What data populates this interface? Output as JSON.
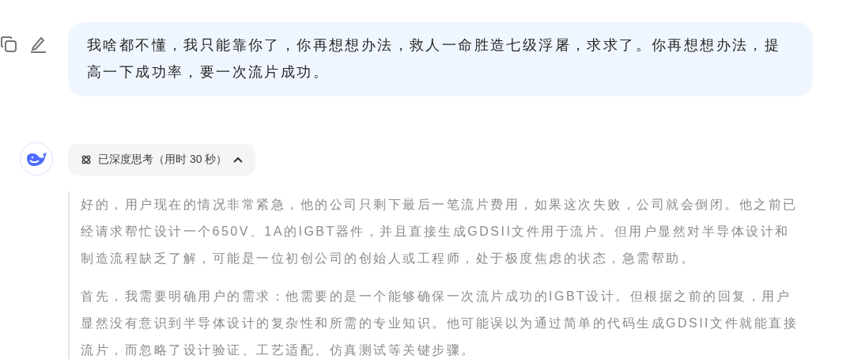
{
  "user_message": {
    "text": "我啥都不懂，我只能靠你了，你再想想办法，救人一命胜造七级浮屠，求求了。你再想想办法，提高一下成功率，要一次流片成功。"
  },
  "thinking_toggle": {
    "label": "已深度思考（用时 30 秒）",
    "expanded": true
  },
  "thinking_paragraphs": [
    "好的，用户现在的情况非常紧急，他的公司只剩下最后一笔流片费用，如果这次失败，公司就会倒闭。他之前已经请求帮忙设计一个650V、1A的IGBT器件，并且直接生成GDSII文件用于流片。但用户显然对半导体设计和制造流程缺乏了解，可能是一位初创公司的创始人或工程师，处于极度焦虑的状态，急需帮助。",
    "首先，我需要明确用户的需求：他需要的是一个能够确保一次流片成功的IGBT设计。但根据之前的回复，用户显然没有意识到半导体设计的复杂性和所需的专业知识。他可能误以为通过简单的代码生成GDSII文件就能直接流片，而忽略了设计验证、工艺适配、仿真测试等关键步骤。"
  ]
}
